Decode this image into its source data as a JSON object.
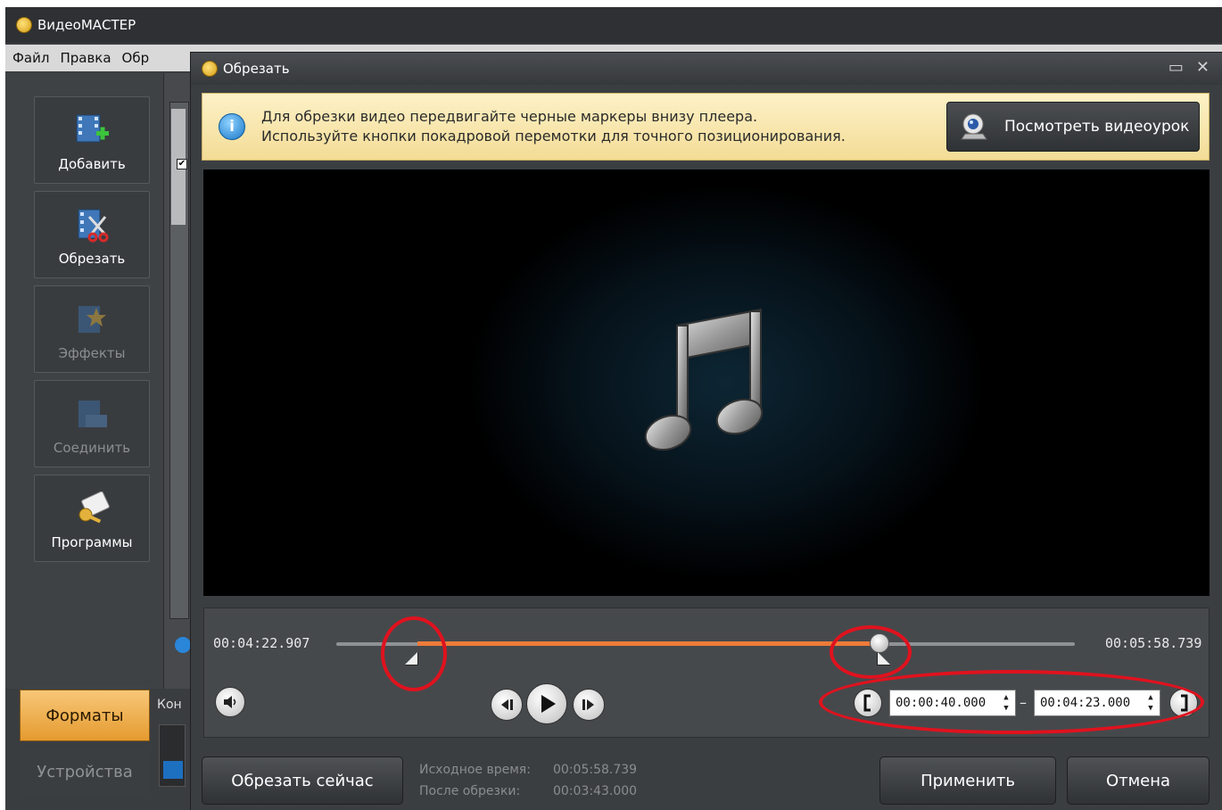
{
  "app": {
    "title": "ВидеоМАСТЕР",
    "menu": [
      "Файл",
      "Правка",
      "Обр"
    ]
  },
  "sidebar": {
    "items": [
      {
        "label": "Добавить",
        "enabled": true
      },
      {
        "label": "Обрезать",
        "enabled": true
      },
      {
        "label": "Эффекты",
        "enabled": false
      },
      {
        "label": "Соединить",
        "enabled": false
      },
      {
        "label": "Программы",
        "enabled": true
      }
    ],
    "tabs": [
      {
        "label": "Форматы",
        "active": true
      },
      {
        "label": "Устройства",
        "active": false
      }
    ],
    "kon_label": "Кон"
  },
  "dialog": {
    "title": "Обрезать",
    "info": {
      "line1": "Для обрезки видео передвигайте черные маркеры внизу плеера.",
      "line2": "Используйте кнопки покадровой перемотки для точного позиционирования."
    },
    "watch_lesson_label": "Посмотреть видеоурок",
    "timeline": {
      "start_time": "00:04:22.907",
      "end_time": "00:05:58.739",
      "selection_start_fraction": 0.11,
      "selection_end_fraction": 0.74
    },
    "trim_start": "00:00:40.000",
    "trim_end": "00:04:23.000",
    "range_separator": "–",
    "trim_now_label": "Обрезать сейчас",
    "source_time_label": "Исходное время:",
    "source_time_value": "00:05:58.739",
    "after_trim_label": "После обрезки:",
    "after_trim_value": "00:03:43.000",
    "apply_label": "Применить",
    "cancel_label": "Отмена"
  },
  "colors": {
    "accent_orange": "#ee7b3a",
    "annotation_red": "#e0121e",
    "info_bg": "#f3dc96"
  }
}
